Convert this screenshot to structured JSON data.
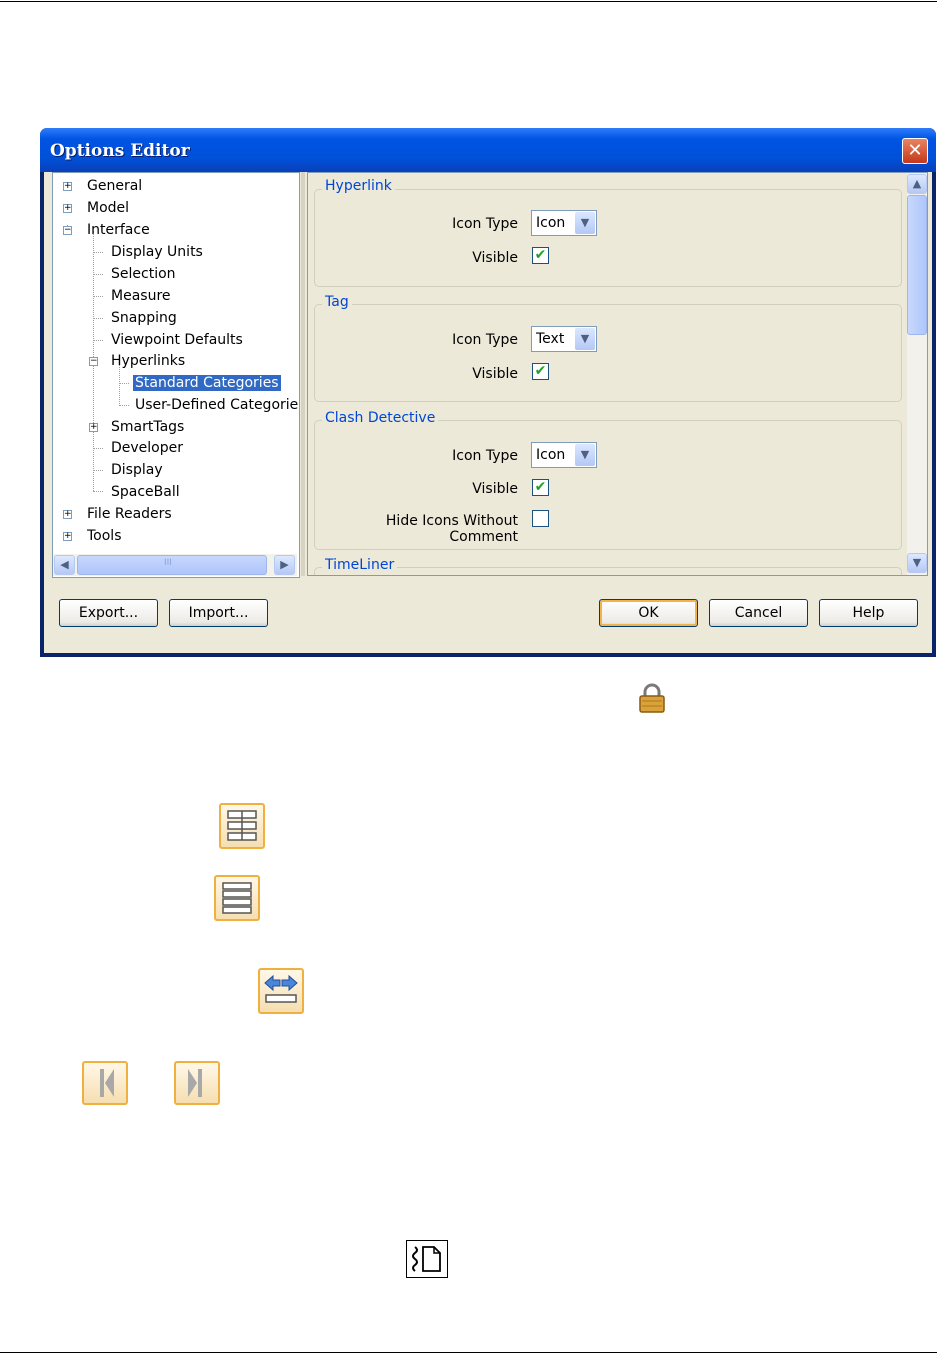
{
  "dialog": {
    "title": "Options Editor",
    "close_symbol": "✕"
  },
  "tree": {
    "items": [
      {
        "label": "General",
        "expander": "+"
      },
      {
        "label": "Model",
        "expander": "+"
      },
      {
        "label": "Interface",
        "expander": "−"
      },
      {
        "label": "Display Units"
      },
      {
        "label": "Selection"
      },
      {
        "label": "Measure"
      },
      {
        "label": "Snapping"
      },
      {
        "label": "Viewpoint Defaults"
      },
      {
        "label": "Hyperlinks",
        "expander": "−"
      },
      {
        "label": "Standard Categories",
        "selected": true
      },
      {
        "label": "User-Defined Categories"
      },
      {
        "label": "SmartTags",
        "expander": "+"
      },
      {
        "label": "Developer"
      },
      {
        "label": "Display"
      },
      {
        "label": "SpaceBall"
      },
      {
        "label": "File Readers",
        "expander": "+"
      },
      {
        "label": "Tools",
        "expander": "+"
      }
    ],
    "scroll_left": "◀",
    "scroll_right": "▶",
    "thumb_grip": "III"
  },
  "groups": {
    "hyperlink": {
      "title": "Hyperlink",
      "icon_type_label": "Icon Type",
      "icon_type_value": "Icon",
      "visible_label": "Visible",
      "visible_checked": true
    },
    "tag": {
      "title": "Tag",
      "icon_type_label": "Icon Type",
      "icon_type_value": "Text",
      "visible_label": "Visible",
      "visible_checked": true
    },
    "clash": {
      "title": "Clash Detective",
      "icon_type_label": "Icon Type",
      "icon_type_value": "Icon",
      "visible_label": "Visible",
      "visible_checked": true,
      "hide_label": "Hide Icons Without Comment",
      "hide_checked": false
    },
    "timeliner": {
      "title": "TimeLiner"
    }
  },
  "checkmark": "✔",
  "combo_arrow": "▼",
  "vscroll": {
    "up": "▲",
    "down": "▼"
  },
  "buttons": {
    "export": "Export...",
    "import": "Import...",
    "ok": "OK",
    "cancel": "Cancel",
    "help": "Help"
  }
}
